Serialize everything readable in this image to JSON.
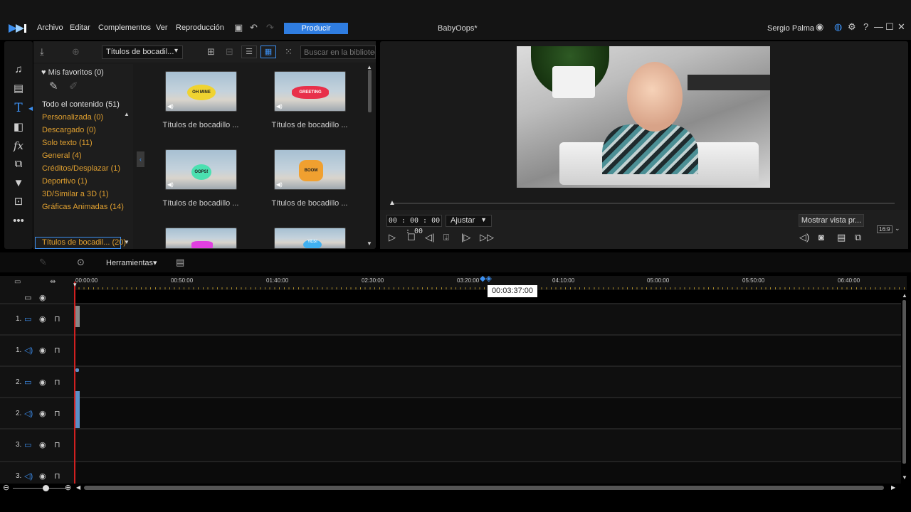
{
  "menu": {
    "items": [
      "Archivo",
      "Editar",
      "Complementos",
      "Ver",
      "Reproducción"
    ],
    "produce_label": "Producir"
  },
  "app_title": "BabyOops*",
  "user_name": "Sergio Palma",
  "library": {
    "dropdown_value": "Títulos de bocadil...",
    "search_placeholder": "Buscar en la biblioteca",
    "favorites_label": "Mis favoritos",
    "favorites_count": "(0)",
    "categories": [
      {
        "label": "Todo el contenido (51)"
      },
      {
        "label": "Personalizada   (0)"
      },
      {
        "label": "Descargado   (0)"
      },
      {
        "label": "Solo texto   (11)"
      },
      {
        "label": "General   (4)"
      },
      {
        "label": "Créditos/Desplazar   (1)"
      },
      {
        "label": "Deportivo   (1)"
      },
      {
        "label": "3D/Similar a 3D   (1)"
      },
      {
        "label": "Gráficas Animadas   (14)"
      },
      {
        "label": "Títulos de bocadil...   (20)"
      }
    ],
    "thumbnails": [
      {
        "label": "Títulos de bocadillo ...",
        "bubble": "OH MINE"
      },
      {
        "label": "Títulos de bocadillo ...",
        "bubble": "GREETING"
      },
      {
        "label": "Títulos de bocadillo ...",
        "bubble": "OOPS!"
      },
      {
        "label": "Títulos de bocadillo ...",
        "bubble": "BOOM"
      },
      {
        "label": "",
        "bubble": ""
      },
      {
        "label": "",
        "bubble": "YES!"
      }
    ]
  },
  "preview": {
    "timecode": "00 : 00 : 00 : 00",
    "fit_value": "Ajustar",
    "show_preview_label": "Mostrar vista pr...",
    "aspect_ratio": "16:9"
  },
  "timeline": {
    "tools_label": "Herramientas",
    "ruler_labels": [
      "00:00:00",
      "00:50:00",
      "01:40:00",
      "02:30:00",
      "03:20:00",
      "04:10:00",
      "05:00:00",
      "05:50:00",
      "06:40:00"
    ],
    "tooltip_time": "00:03:37:00",
    "tracks": [
      {
        "label": "1.",
        "type": "video"
      },
      {
        "label": "1.",
        "type": "audio"
      },
      {
        "label": "2.",
        "type": "video"
      },
      {
        "label": "2.",
        "type": "audio"
      },
      {
        "label": "3.",
        "type": "video"
      },
      {
        "label": "3.",
        "type": "audio"
      }
    ]
  },
  "colors": {
    "accent": "#3c8ff0",
    "produce_button": "#2f7de1",
    "category_highlight": "#e0a030",
    "playhead": "#d02020"
  }
}
